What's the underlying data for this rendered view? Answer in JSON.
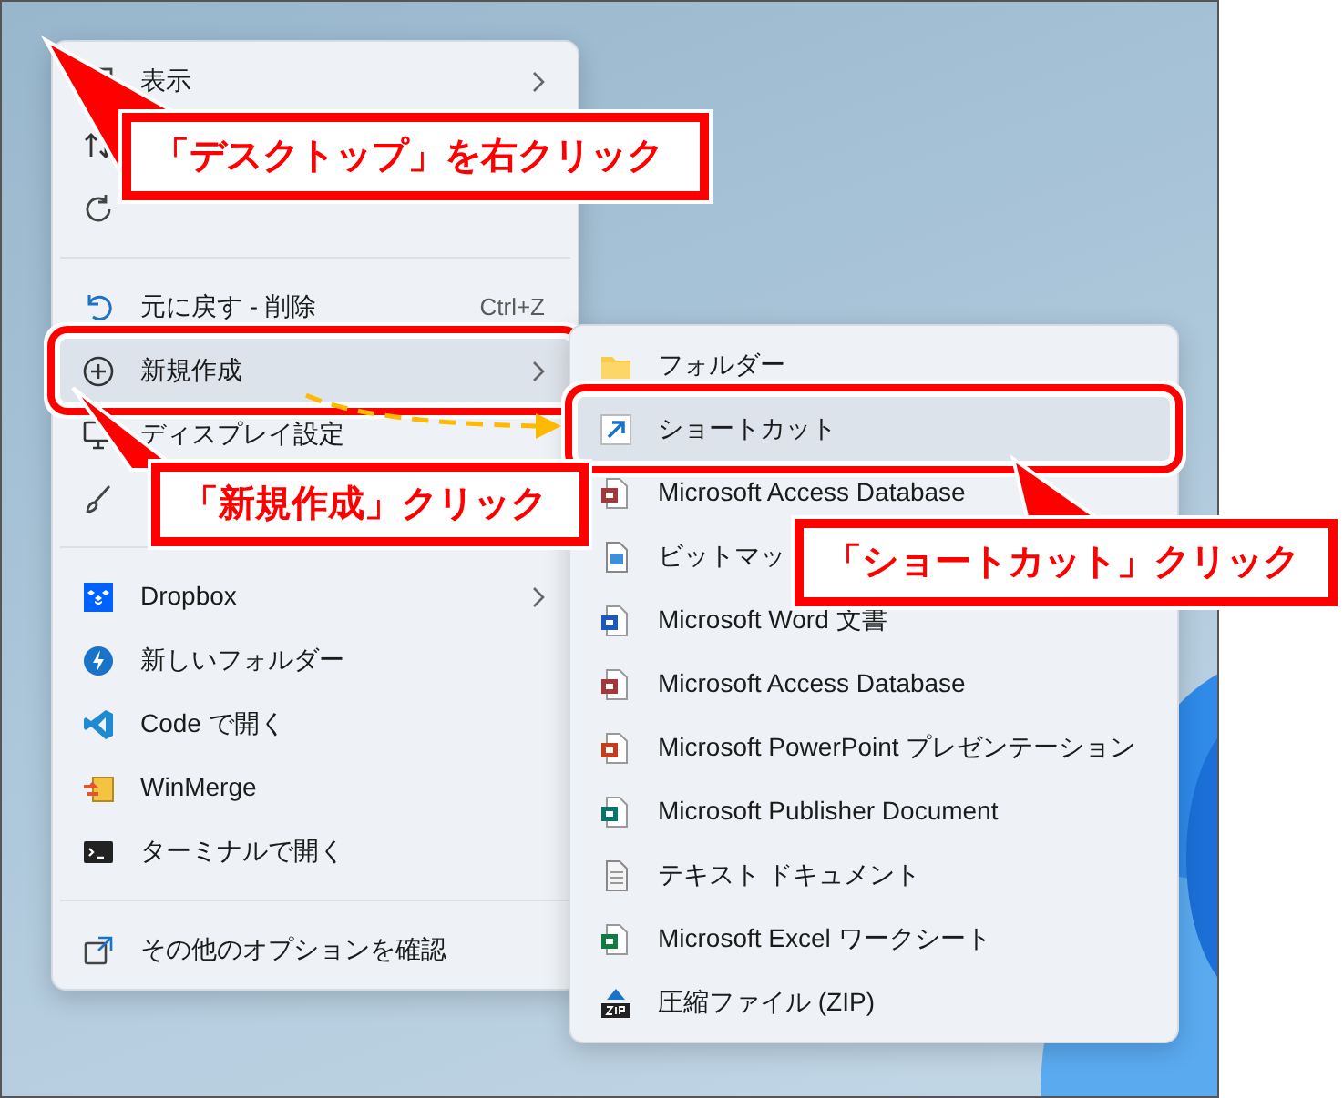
{
  "context_menu": {
    "items": [
      {
        "kind": "item",
        "label": "表示",
        "has_submenu": true,
        "selected": false
      },
      {
        "kind": "item",
        "selected": false
      },
      {
        "kind": "item",
        "selected": false
      },
      {
        "kind": "separator"
      },
      {
        "kind": "item",
        "label": "元に戻す - 削除",
        "shortcut": "Ctrl+Z",
        "has_submenu": false,
        "selected": false
      },
      {
        "kind": "item",
        "label": "新規作成",
        "has_submenu": true,
        "selected": true
      },
      {
        "kind": "item",
        "label": "ディスプレイ設定",
        "has_submenu": false,
        "selected": false
      },
      {
        "kind": "item",
        "selected": false
      },
      {
        "kind": "separator"
      },
      {
        "kind": "item",
        "label": "Dropbox",
        "has_submenu": true,
        "selected": false
      },
      {
        "kind": "item",
        "label": "新しいフォルダー",
        "has_submenu": false,
        "selected": false
      },
      {
        "kind": "item",
        "label": "Code で開く",
        "has_submenu": false,
        "selected": false
      },
      {
        "kind": "item",
        "label": "WinMerge",
        "has_submenu": false,
        "selected": false
      },
      {
        "kind": "item",
        "label": "ターミナルで開く",
        "has_submenu": false,
        "selected": false
      },
      {
        "kind": "separator"
      },
      {
        "kind": "item",
        "label": "その他のオプションを確認",
        "has_submenu": false,
        "selected": false
      }
    ]
  },
  "submenu": {
    "items": [
      {
        "label": "フォルダー",
        "selected": false
      },
      {
        "label": "ショートカット",
        "selected": true
      },
      {
        "label": "Microsoft Access Database",
        "selected": false
      },
      {
        "label": "ビットマッ",
        "selected": false
      },
      {
        "label": "Microsoft Word 文書",
        "selected": false
      },
      {
        "label": "Microsoft Access Database",
        "selected": false
      },
      {
        "label": "Microsoft PowerPoint プレゼンテーション",
        "selected": false
      },
      {
        "label": "Microsoft Publisher Document",
        "selected": false
      },
      {
        "label": "テキスト ドキュメント",
        "selected": false
      },
      {
        "label": "Microsoft Excel ワークシート",
        "selected": false
      },
      {
        "label": "圧縮ファイル (ZIP)",
        "selected": false
      }
    ]
  },
  "annotations": [
    {
      "text": "「デスクトップ」を右クリック"
    },
    {
      "text": "「新規作成」クリック"
    },
    {
      "text": "「ショートカット」クリック"
    }
  ]
}
